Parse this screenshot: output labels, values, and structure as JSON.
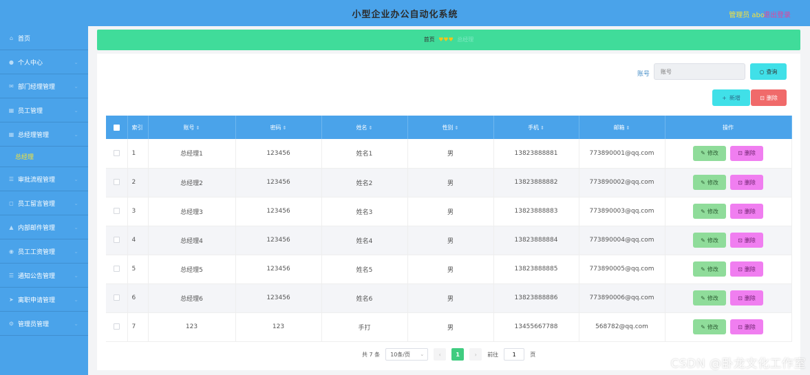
{
  "header": {
    "title": "小型企业办公自动化系统",
    "admin": "管理员 abo",
    "logout": "退出登录"
  },
  "sidebar": {
    "items": [
      {
        "icon": "home-icon",
        "label": "首页"
      },
      {
        "icon": "user-icon",
        "label": "个人中心"
      },
      {
        "icon": "mail-icon",
        "label": "部门经理管理"
      },
      {
        "icon": "grid-icon",
        "label": "员工管理"
      },
      {
        "icon": "grid-icon",
        "label": "总经理管理"
      },
      {
        "icon": "",
        "label": "总经理"
      },
      {
        "icon": "list-icon",
        "label": "审批流程管理"
      },
      {
        "icon": "comment-icon",
        "label": "员工留言管理"
      },
      {
        "icon": "chart-icon",
        "label": "内部邮件管理"
      },
      {
        "icon": "location-icon",
        "label": "员工工资管理"
      },
      {
        "icon": "list-icon",
        "label": "通知公告管理"
      },
      {
        "icon": "send-icon",
        "label": "离职申请管理"
      },
      {
        "icon": "gear-icon",
        "label": "管理员管理"
      }
    ]
  },
  "breadcrumb": {
    "home": "首页",
    "separator": "♥♥♥",
    "current": "总经理"
  },
  "search": {
    "label": "账号",
    "placeholder": "账号",
    "query_button": "查询"
  },
  "actions": {
    "add": "新增",
    "delete": "删除"
  },
  "table": {
    "columns": [
      "索引",
      "账号",
      "密码",
      "姓名",
      "性别",
      "手机",
      "邮箱",
      "操作"
    ],
    "rows": [
      [
        "1",
        "总经理1",
        "123456",
        "姓名1",
        "男",
        "13823888881",
        "773890001@qq.com"
      ],
      [
        "2",
        "总经理2",
        "123456",
        "姓名2",
        "男",
        "13823888882",
        "773890002@qq.com"
      ],
      [
        "3",
        "总经理3",
        "123456",
        "姓名3",
        "男",
        "13823888883",
        "773890003@qq.com"
      ],
      [
        "4",
        "总经理4",
        "123456",
        "姓名4",
        "男",
        "13823888884",
        "773890004@qq.com"
      ],
      [
        "5",
        "总经理5",
        "123456",
        "姓名5",
        "男",
        "13823888885",
        "773890005@qq.com"
      ],
      [
        "6",
        "总经理6",
        "123456",
        "姓名6",
        "男",
        "13823888886",
        "773890006@qq.com"
      ],
      [
        "7",
        "123",
        "123",
        "手打",
        "男",
        "13455667788",
        "568782@qq.com"
      ]
    ],
    "edit_label": "修改",
    "delete_label": "删除"
  },
  "pagination": {
    "total": "共 7 条",
    "page_size": "10条/页",
    "current_page": "1",
    "goto_prefix": "前往",
    "goto_value": "1",
    "goto_suffix": "页"
  },
  "watermark": "CSDN @卧龙文化工作室"
}
